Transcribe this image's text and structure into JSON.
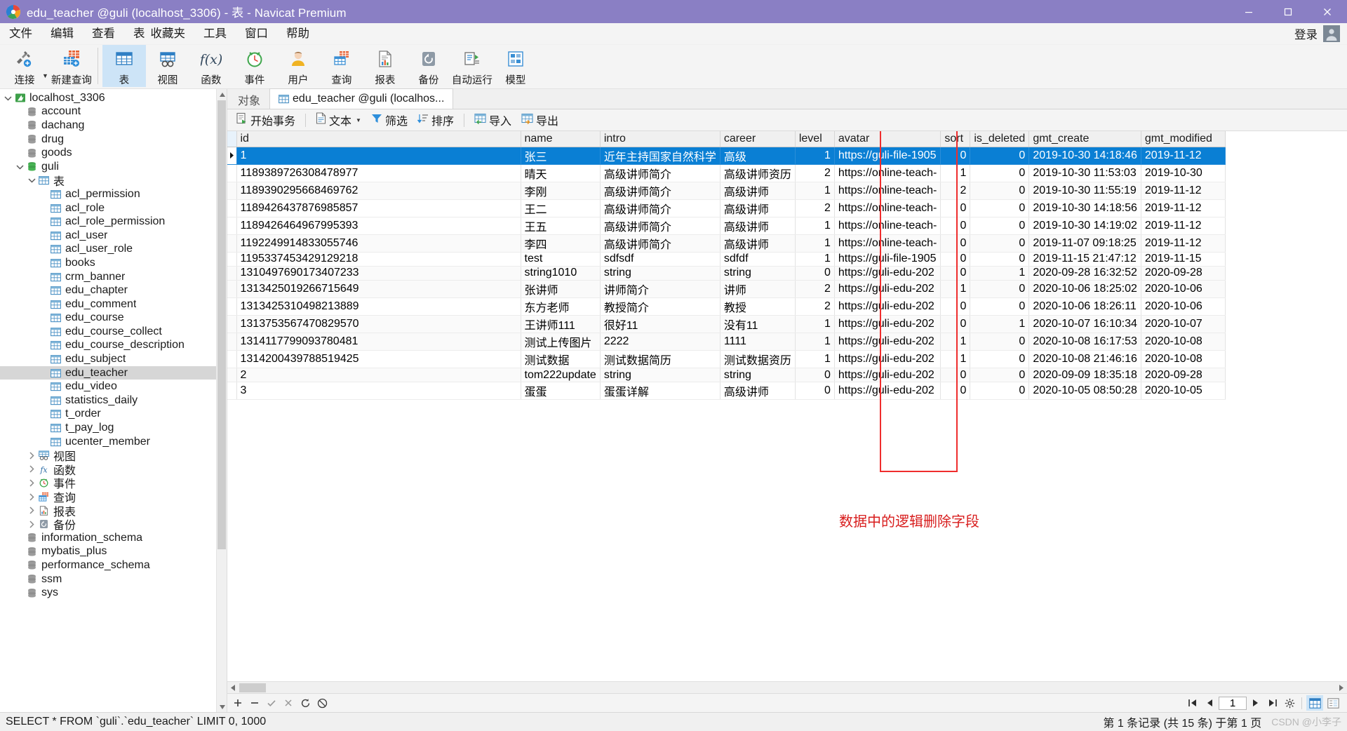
{
  "window": {
    "title": "edu_teacher @guli (localhost_3306) - 表 - Navicat Premium",
    "minimize": "minimize-icon",
    "maximize": "maximize-icon",
    "close": "close-icon"
  },
  "menubar": {
    "items": [
      "文件",
      "编辑",
      "查看",
      "表",
      "收藏夹",
      "工具",
      "窗口",
      "帮助"
    ],
    "login_label": "登录"
  },
  "toolbar": {
    "items": [
      {
        "label": "连接",
        "icon": "connection-icon",
        "selected": false
      },
      {
        "label": "新建查询",
        "icon": "new-query-icon",
        "selected": false
      },
      {
        "label": "表",
        "icon": "table-icon",
        "selected": true
      },
      {
        "label": "视图",
        "icon": "view-icon",
        "selected": false
      },
      {
        "label": "函数",
        "icon": "function-icon",
        "selected": false
      },
      {
        "label": "事件",
        "icon": "event-icon",
        "selected": false
      },
      {
        "label": "用户",
        "icon": "user-icon",
        "selected": false
      },
      {
        "label": "查询",
        "icon": "query-icon",
        "selected": false
      },
      {
        "label": "报表",
        "icon": "report-icon",
        "selected": false
      },
      {
        "label": "备份",
        "icon": "backup-icon",
        "selected": false
      },
      {
        "label": "自动运行",
        "icon": "autorun-icon",
        "selected": false
      },
      {
        "label": "模型",
        "icon": "model-icon",
        "selected": false
      }
    ]
  },
  "sidebar": {
    "items": [
      {
        "label": "localhost_3306",
        "indent": 0,
        "twisty": "down",
        "icon": "connection-node-icon",
        "selected": false
      },
      {
        "label": "account",
        "indent": 1,
        "twisty": "none",
        "icon": "database-icon",
        "selected": false
      },
      {
        "label": "dachang",
        "indent": 1,
        "twisty": "none",
        "icon": "database-icon",
        "selected": false
      },
      {
        "label": "drug",
        "indent": 1,
        "twisty": "none",
        "icon": "database-icon",
        "selected": false
      },
      {
        "label": "goods",
        "indent": 1,
        "twisty": "none",
        "icon": "database-icon",
        "selected": false
      },
      {
        "label": "guli",
        "indent": 1,
        "twisty": "down",
        "icon": "database-open-icon",
        "selected": false
      },
      {
        "label": "表",
        "indent": 2,
        "twisty": "down",
        "icon": "table-folder-icon",
        "selected": false
      },
      {
        "label": "acl_permission",
        "indent": 3,
        "twisty": "none",
        "icon": "table-item-icon",
        "selected": false
      },
      {
        "label": "acl_role",
        "indent": 3,
        "twisty": "none",
        "icon": "table-item-icon",
        "selected": false
      },
      {
        "label": "acl_role_permission",
        "indent": 3,
        "twisty": "none",
        "icon": "table-item-icon",
        "selected": false
      },
      {
        "label": "acl_user",
        "indent": 3,
        "twisty": "none",
        "icon": "table-item-icon",
        "selected": false
      },
      {
        "label": "acl_user_role",
        "indent": 3,
        "twisty": "none",
        "icon": "table-item-icon",
        "selected": false
      },
      {
        "label": "books",
        "indent": 3,
        "twisty": "none",
        "icon": "table-item-icon",
        "selected": false
      },
      {
        "label": "crm_banner",
        "indent": 3,
        "twisty": "none",
        "icon": "table-item-icon",
        "selected": false
      },
      {
        "label": "edu_chapter",
        "indent": 3,
        "twisty": "none",
        "icon": "table-item-icon",
        "selected": false
      },
      {
        "label": "edu_comment",
        "indent": 3,
        "twisty": "none",
        "icon": "table-item-icon",
        "selected": false
      },
      {
        "label": "edu_course",
        "indent": 3,
        "twisty": "none",
        "icon": "table-item-icon",
        "selected": false
      },
      {
        "label": "edu_course_collect",
        "indent": 3,
        "twisty": "none",
        "icon": "table-item-icon",
        "selected": false
      },
      {
        "label": "edu_course_description",
        "indent": 3,
        "twisty": "none",
        "icon": "table-item-icon",
        "selected": false
      },
      {
        "label": "edu_subject",
        "indent": 3,
        "twisty": "none",
        "icon": "table-item-icon",
        "selected": false
      },
      {
        "label": "edu_teacher",
        "indent": 3,
        "twisty": "none",
        "icon": "table-item-icon",
        "selected": true
      },
      {
        "label": "edu_video",
        "indent": 3,
        "twisty": "none",
        "icon": "table-item-icon",
        "selected": false
      },
      {
        "label": "statistics_daily",
        "indent": 3,
        "twisty": "none",
        "icon": "table-item-icon",
        "selected": false
      },
      {
        "label": "t_order",
        "indent": 3,
        "twisty": "none",
        "icon": "table-item-icon",
        "selected": false
      },
      {
        "label": "t_pay_log",
        "indent": 3,
        "twisty": "none",
        "icon": "table-item-icon",
        "selected": false
      },
      {
        "label": "ucenter_member",
        "indent": 3,
        "twisty": "none",
        "icon": "table-item-icon",
        "selected": false
      },
      {
        "label": "视图",
        "indent": 2,
        "twisty": "right",
        "icon": "view-folder-icon",
        "selected": false
      },
      {
        "label": "函数",
        "indent": 2,
        "twisty": "right",
        "icon": "function-folder-icon",
        "selected": false
      },
      {
        "label": "事件",
        "indent": 2,
        "twisty": "right",
        "icon": "event-folder-icon",
        "selected": false
      },
      {
        "label": "查询",
        "indent": 2,
        "twisty": "right",
        "icon": "query-folder-icon",
        "selected": false
      },
      {
        "label": "报表",
        "indent": 2,
        "twisty": "right",
        "icon": "report-folder-icon",
        "selected": false
      },
      {
        "label": "备份",
        "indent": 2,
        "twisty": "right",
        "icon": "backup-folder-icon",
        "selected": false
      },
      {
        "label": "information_schema",
        "indent": 1,
        "twisty": "none",
        "icon": "database-icon",
        "selected": false
      },
      {
        "label": "mybatis_plus",
        "indent": 1,
        "twisty": "none",
        "icon": "database-icon",
        "selected": false
      },
      {
        "label": "performance_schema",
        "indent": 1,
        "twisty": "none",
        "icon": "database-icon",
        "selected": false
      },
      {
        "label": "ssm",
        "indent": 1,
        "twisty": "none",
        "icon": "database-icon",
        "selected": false
      },
      {
        "label": "sys",
        "indent": 1,
        "twisty": "none",
        "icon": "database-icon",
        "selected": false
      }
    ]
  },
  "tabs": [
    {
      "label": "对象",
      "icon": "none",
      "active": false
    },
    {
      "label": "edu_teacher @guli (localhos...",
      "icon": "table-item-icon",
      "active": true
    }
  ],
  "gridtools": [
    {
      "label": "开始事务",
      "icon": "transaction-icon",
      "caret": false
    },
    {
      "label": "文本",
      "icon": "text-icon",
      "caret": true
    },
    {
      "label": "筛选",
      "icon": "filter-icon",
      "caret": false
    },
    {
      "label": "排序",
      "icon": "sort-icon",
      "caret": false
    },
    {
      "label": "导入",
      "icon": "import-icon",
      "caret": false
    },
    {
      "label": "导出",
      "icon": "export-icon",
      "caret": false
    }
  ],
  "table": {
    "columns": [
      "id",
      "name",
      "intro",
      "career",
      "level",
      "avatar",
      "sort",
      "is_deleted",
      "gmt_create",
      "gmt_modified"
    ],
    "rows": [
      {
        "id": "1",
        "name": "张三",
        "intro": "近年主持国家自然科学",
        "career": "高级",
        "level": "1",
        "avatar": "https://guli-file-1905",
        "sort": "0",
        "is_deleted": "0",
        "gmt_create": "2019-10-30 14:18:46",
        "gmt_modified": "2019-11-12",
        "selected": true
      },
      {
        "id": "1189389726308478977",
        "name": "晴天",
        "intro": "高级讲师简介",
        "career": "高级讲师资历",
        "level": "2",
        "avatar": "https://online-teach-",
        "sort": "1",
        "is_deleted": "0",
        "gmt_create": "2019-10-30 11:53:03",
        "gmt_modified": "2019-10-30"
      },
      {
        "id": "1189390295668469762",
        "name": "李刚",
        "intro": "高级讲师简介",
        "career": "高级讲师",
        "level": "1",
        "avatar": "https://online-teach-",
        "sort": "2",
        "is_deleted": "0",
        "gmt_create": "2019-10-30 11:55:19",
        "gmt_modified": "2019-11-12"
      },
      {
        "id": "1189426437876985857",
        "name": "王二",
        "intro": "高级讲师简介",
        "career": "高级讲师",
        "level": "2",
        "avatar": "https://online-teach-",
        "sort": "0",
        "is_deleted": "0",
        "gmt_create": "2019-10-30 14:18:56",
        "gmt_modified": "2019-11-12"
      },
      {
        "id": "1189426464967995393",
        "name": "王五",
        "intro": "高级讲师简介",
        "career": "高级讲师",
        "level": "1",
        "avatar": "https://online-teach-",
        "sort": "0",
        "is_deleted": "0",
        "gmt_create": "2019-10-30 14:19:02",
        "gmt_modified": "2019-11-12"
      },
      {
        "id": "1192249914833055746",
        "name": "李四",
        "intro": "高级讲师简介",
        "career": "高级讲师",
        "level": "1",
        "avatar": "https://online-teach-",
        "sort": "0",
        "is_deleted": "0",
        "gmt_create": "2019-11-07 09:18:25",
        "gmt_modified": "2019-11-12"
      },
      {
        "id": "1195337453429129218",
        "name": "test",
        "intro": "sdfsdf",
        "career": "sdfdf",
        "level": "1",
        "avatar": "https://guli-file-1905",
        "sort": "0",
        "is_deleted": "0",
        "gmt_create": "2019-11-15 21:47:12",
        "gmt_modified": "2019-11-15"
      },
      {
        "id": "1310497690173407233",
        "name": "string1010",
        "intro": "string",
        "career": "string",
        "level": "0",
        "avatar": "https://guli-edu-202",
        "sort": "0",
        "is_deleted": "1",
        "gmt_create": "2020-09-28 16:32:52",
        "gmt_modified": "2020-09-28"
      },
      {
        "id": "1313425019266715649",
        "name": "张讲师",
        "intro": "讲师简介",
        "career": "讲师",
        "level": "2",
        "avatar": "https://guli-edu-202",
        "sort": "1",
        "is_deleted": "0",
        "gmt_create": "2020-10-06 18:25:02",
        "gmt_modified": "2020-10-06"
      },
      {
        "id": "1313425310498213889",
        "name": "东方老师",
        "intro": "教授简介",
        "career": "教授",
        "level": "2",
        "avatar": "https://guli-edu-202",
        "sort": "0",
        "is_deleted": "0",
        "gmt_create": "2020-10-06 18:26:11",
        "gmt_modified": "2020-10-06"
      },
      {
        "id": "1313753567470829570",
        "name": "王讲师111",
        "intro": "很好11",
        "career": "没有11",
        "level": "1",
        "avatar": "https://guli-edu-202",
        "sort": "0",
        "is_deleted": "1",
        "gmt_create": "2020-10-07 16:10:34",
        "gmt_modified": "2020-10-07"
      },
      {
        "id": "1314117799093780481",
        "name": "测试上传图片",
        "intro": "2222",
        "career": "1111",
        "level": "1",
        "avatar": "https://guli-edu-202",
        "sort": "1",
        "is_deleted": "0",
        "gmt_create": "2020-10-08 16:17:53",
        "gmt_modified": "2020-10-08"
      },
      {
        "id": "1314200439788519425",
        "name": "测试数据",
        "intro": "测试数据简历",
        "career": "测试数据资历",
        "level": "1",
        "avatar": "https://guli-edu-202",
        "sort": "1",
        "is_deleted": "0",
        "gmt_create": "2020-10-08 21:46:16",
        "gmt_modified": "2020-10-08"
      },
      {
        "id": "2",
        "name": "tom222update",
        "intro": "string",
        "career": "string",
        "level": "0",
        "avatar": "https://guli-edu-202",
        "sort": "0",
        "is_deleted": "0",
        "gmt_create": "2020-09-09 18:35:18",
        "gmt_modified": "2020-09-28"
      },
      {
        "id": "3",
        "name": "蛋蛋",
        "intro": "蛋蛋详解",
        "career": "高级讲师",
        "level": "0",
        "avatar": "https://guli-edu-202",
        "sort": "0",
        "is_deleted": "0",
        "gmt_create": "2020-10-05 08:50:28",
        "gmt_modified": "2020-10-05"
      }
    ]
  },
  "annotation": {
    "text": "数据中的逻辑删除字段",
    "color": "#d81d1d",
    "box_color": "#ef2d2d"
  },
  "navbar": {
    "buttons": [
      "add-record-icon",
      "delete-record-icon",
      "apply-change-icon",
      "cancel-change-icon",
      "refresh-icon",
      "stop-icon"
    ],
    "page_value": "1",
    "right_buttons": [
      "first-page-icon",
      "prev-page-icon",
      "next-page-icon",
      "last-page-icon",
      "settings-icon",
      "grid-view-icon",
      "form-view-icon"
    ]
  },
  "statusbar": {
    "sql": "SELECT * FROM `guli`.`edu_teacher` LIMIT 0, 1000",
    "record_info": "第 1 条记录 (共 15 条) 于第 1 页",
    "watermark": "CSDN @小李子"
  }
}
